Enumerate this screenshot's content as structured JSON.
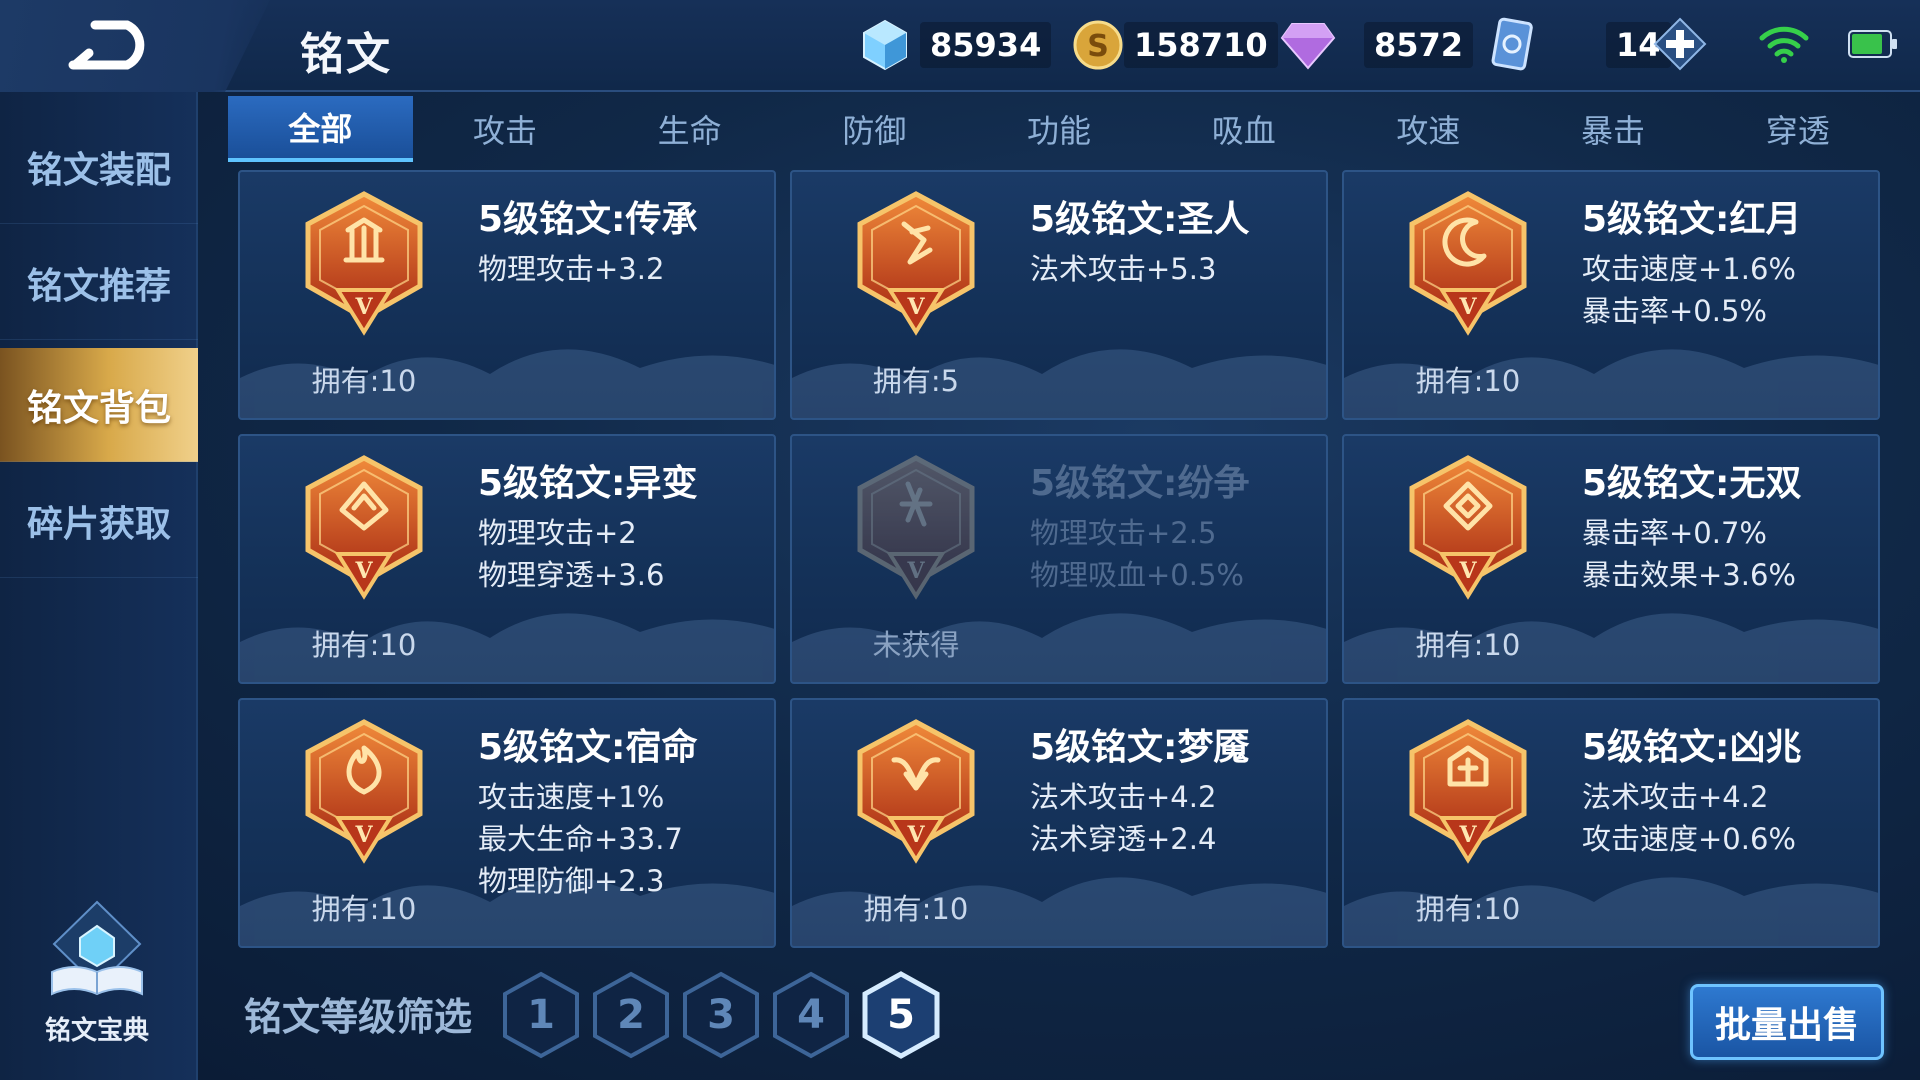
{
  "header": {
    "title": "铭文",
    "currencies": [
      {
        "icon": "crystal-icon",
        "value": "85934"
      },
      {
        "icon": "gold-coin-icon",
        "value": "158710"
      },
      {
        "icon": "diamond-icon",
        "value": "8572"
      },
      {
        "icon": "ticket-icon",
        "value": "14"
      }
    ]
  },
  "sidebar": {
    "items": [
      {
        "label": "铭文装配",
        "active": false
      },
      {
        "label": "铭文推荐",
        "active": false
      },
      {
        "label": "铭文背包",
        "active": true
      },
      {
        "label": "碎片获取",
        "active": false
      }
    ],
    "codex_label": "铭文宝典"
  },
  "tabs": [
    {
      "label": "全部",
      "active": true
    },
    {
      "label": "攻击",
      "active": false
    },
    {
      "label": "生命",
      "active": false
    },
    {
      "label": "防御",
      "active": false
    },
    {
      "label": "功能",
      "active": false
    },
    {
      "label": "吸血",
      "active": false
    },
    {
      "label": "攻速",
      "active": false
    },
    {
      "label": "暴击",
      "active": false
    },
    {
      "label": "穿透",
      "active": false
    }
  ],
  "cards": [
    {
      "name": "5级铭文:传承",
      "stats": [
        "物理攻击+3.2"
      ],
      "owned": "拥有:10",
      "locked": false,
      "icon": "heritage-emblem-icon"
    },
    {
      "name": "5级铭文:圣人",
      "stats": [
        "法术攻击+5.3"
      ],
      "owned": "拥有:5",
      "locked": false,
      "icon": "saint-emblem-icon"
    },
    {
      "name": "5级铭文:红月",
      "stats": [
        "攻击速度+1.6%",
        "暴击率+0.5%"
      ],
      "owned": "拥有:10",
      "locked": false,
      "icon": "red-moon-emblem-icon"
    },
    {
      "name": "5级铭文:异变",
      "stats": [
        "物理攻击+2",
        "物理穿透+3.6"
      ],
      "owned": "拥有:10",
      "locked": false,
      "icon": "mutation-emblem-icon"
    },
    {
      "name": "5级铭文:纷争",
      "stats": [
        "物理攻击+2.5",
        "物理吸血+0.5%"
      ],
      "owned": "未获得",
      "locked": true,
      "icon": "strife-emblem-icon"
    },
    {
      "name": "5级铭文:无双",
      "stats": [
        "暴击率+0.7%",
        "暴击效果+3.6%"
      ],
      "owned": "拥有:10",
      "locked": false,
      "icon": "peerless-emblem-icon"
    },
    {
      "name": "5级铭文:宿命",
      "stats": [
        "攻击速度+1%",
        "最大生命+33.7",
        "物理防御+2.3"
      ],
      "owned": "拥有:10",
      "locked": false,
      "icon": "destiny-emblem-icon"
    },
    {
      "name": "5级铭文:梦魇",
      "stats": [
        "法术攻击+4.2",
        "法术穿透+2.4"
      ],
      "owned": "拥有:10",
      "locked": false,
      "icon": "nightmare-emblem-icon"
    },
    {
      "name": "5级铭文:凶兆",
      "stats": [
        "法术攻击+4.2",
        "攻击速度+0.6%"
      ],
      "owned": "拥有:10",
      "locked": false,
      "icon": "omen-emblem-icon"
    }
  ],
  "emblem_roman_numeral": "V",
  "filter": {
    "label": "铭文等级筛选",
    "levels": [
      "1",
      "2",
      "3",
      "4",
      "5"
    ],
    "selected": "5"
  },
  "sell_button": "批量出售",
  "colors": {
    "accent_blue": "#2b6bc0",
    "active_gold": "#d8a94a",
    "emblem_orange": "#e0602a"
  }
}
